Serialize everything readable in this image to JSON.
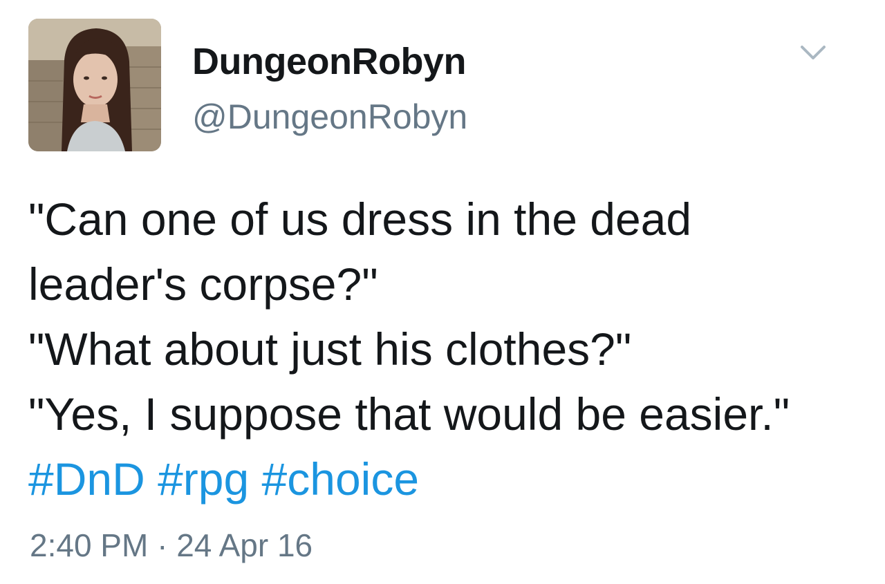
{
  "tweet": {
    "author": {
      "display_name": "DungeonRobyn",
      "handle": "@DungeonRobyn",
      "avatar": "profile-photo"
    },
    "menu_icon": "chevron-down-icon",
    "text_lines": [
      "\"Can one of us dress in the dead",
      "leader's corpse?\"",
      "\"What about just his clothes?\"",
      "\"Yes, I suppose that would be easier.\""
    ],
    "hashtags": [
      "#DnD",
      "#rpg",
      "#choice"
    ],
    "timestamp": "2:40 PM · 24 Apr 16",
    "colors": {
      "text": "#14171a",
      "secondary": "#657786",
      "link": "#1b95e0"
    }
  }
}
